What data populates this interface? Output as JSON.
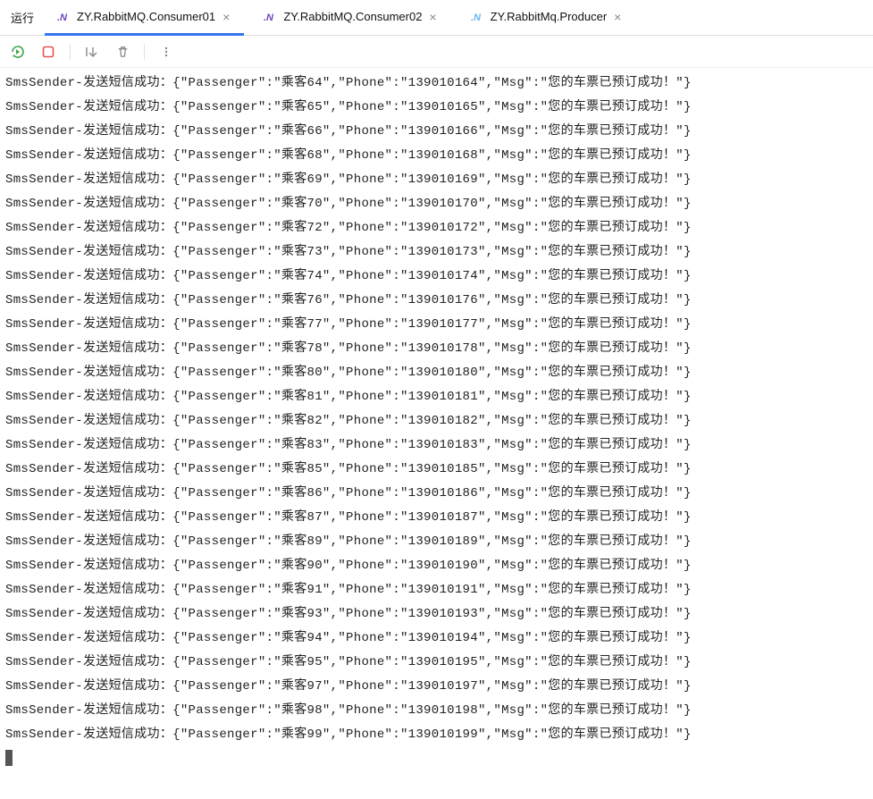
{
  "header": {
    "run_label": "运行",
    "tabs": [
      {
        "label": "ZY.RabbitMQ.Consumer01",
        "active": true
      },
      {
        "label": "ZY.RabbitMQ.Consumer02",
        "active": false
      },
      {
        "label": "ZY.RabbitMq.Producer",
        "active": false
      }
    ]
  },
  "log_template": {
    "prefix": "SmsSender-发送短信成功：",
    "msg": "您的车票已预订成功！"
  },
  "log_entries": [
    {
      "passenger": "乘客64",
      "phone": "139010164"
    },
    {
      "passenger": "乘客65",
      "phone": "139010165"
    },
    {
      "passenger": "乘客66",
      "phone": "139010166"
    },
    {
      "passenger": "乘客68",
      "phone": "139010168"
    },
    {
      "passenger": "乘客69",
      "phone": "139010169"
    },
    {
      "passenger": "乘客70",
      "phone": "139010170"
    },
    {
      "passenger": "乘客72",
      "phone": "139010172"
    },
    {
      "passenger": "乘客73",
      "phone": "139010173"
    },
    {
      "passenger": "乘客74",
      "phone": "139010174"
    },
    {
      "passenger": "乘客76",
      "phone": "139010176"
    },
    {
      "passenger": "乘客77",
      "phone": "139010177"
    },
    {
      "passenger": "乘客78",
      "phone": "139010178"
    },
    {
      "passenger": "乘客80",
      "phone": "139010180"
    },
    {
      "passenger": "乘客81",
      "phone": "139010181"
    },
    {
      "passenger": "乘客82",
      "phone": "139010182"
    },
    {
      "passenger": "乘客83",
      "phone": "139010183"
    },
    {
      "passenger": "乘客85",
      "phone": "139010185"
    },
    {
      "passenger": "乘客86",
      "phone": "139010186"
    },
    {
      "passenger": "乘客87",
      "phone": "139010187"
    },
    {
      "passenger": "乘客89",
      "phone": "139010189"
    },
    {
      "passenger": "乘客90",
      "phone": "139010190"
    },
    {
      "passenger": "乘客91",
      "phone": "139010191"
    },
    {
      "passenger": "乘客93",
      "phone": "139010193"
    },
    {
      "passenger": "乘客94",
      "phone": "139010194"
    },
    {
      "passenger": "乘客95",
      "phone": "139010195"
    },
    {
      "passenger": "乘客97",
      "phone": "139010197"
    },
    {
      "passenger": "乘客98",
      "phone": "139010198"
    },
    {
      "passenger": "乘客99",
      "phone": "139010199"
    }
  ]
}
